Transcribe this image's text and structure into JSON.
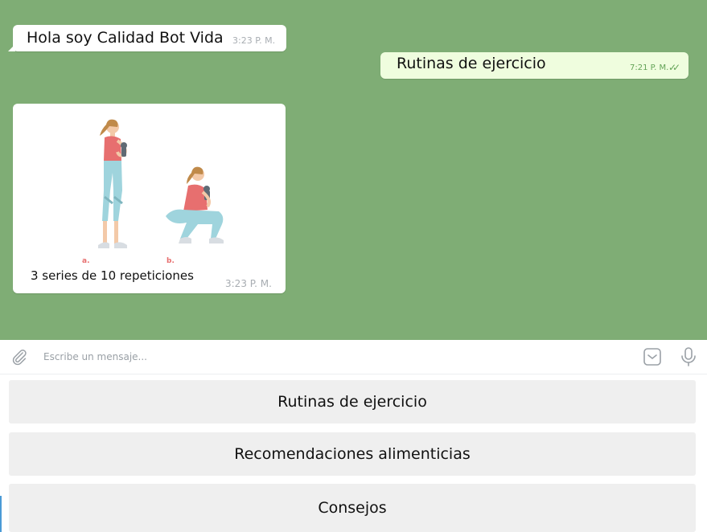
{
  "messages": [
    {
      "text": "Hola soy Calidad Bot Vida",
      "time": "3:23 P. M.",
      "direction": "incoming"
    },
    {
      "text": "Rutinas de ejercicio",
      "time": "7:21 P. M.",
      "direction": "outgoing",
      "status_icon": "double-check-icon"
    },
    {
      "caption": "3 series de 10 repeticiones",
      "time": "3:23 P. M.",
      "direction": "incoming",
      "image_letters": [
        "a.",
        "b."
      ]
    }
  ],
  "input": {
    "placeholder": "Escribe un mensaje..."
  },
  "keyboard": {
    "buttons": [
      "Rutinas de ejercicio",
      "Recomendaciones alimenticias",
      "Consejos"
    ]
  },
  "colors": {
    "chat_background": "#7fad75",
    "incoming_bubble": "#ffffff",
    "outgoing_bubble": "#effdde",
    "outgoing_time": "#63a357",
    "keyboard_button": "#efefef",
    "illustration_top": "#e76f6f",
    "illustration_pants": "#9fd4dd",
    "illustration_skin": "#f3c9a8",
    "illustration_hair": "#c08a4a"
  },
  "icons": [
    "paperclip-icon",
    "emoji-icon",
    "microphone-icon",
    "double-check-icon"
  ]
}
